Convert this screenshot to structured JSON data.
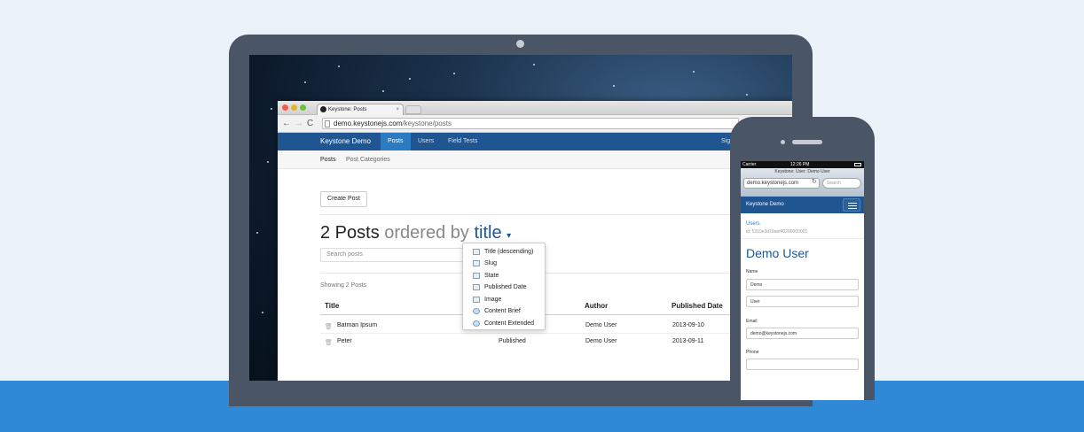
{
  "browser": {
    "tab_title": "Keystone: Posts",
    "url_host": "demo.keystonejs.com",
    "url_path": "/keystone/posts"
  },
  "navbar": {
    "brand": "Keystone Demo",
    "items": [
      "Posts",
      "Users",
      "Field Tests"
    ],
    "right_label": "Sig"
  },
  "subnav": {
    "items": [
      "Posts",
      "Post Categories"
    ]
  },
  "main": {
    "create_button": "Create Post",
    "heading_count": "2 Posts",
    "heading_ordered": "ordered by",
    "heading_sortkey": "title",
    "search_placeholder": "Search posts",
    "showing": "Showing 2 Posts",
    "columns": [
      "Title",
      "Author",
      "Published Date"
    ],
    "rows": [
      {
        "title": "Batman Ipsum",
        "state": "",
        "author": "Demo User",
        "date": "2013-09-10"
      },
      {
        "title": "Peter",
        "state": "Published",
        "author": "Demo User",
        "date": "2013-09-11"
      }
    ]
  },
  "sort_dropdown": {
    "options": [
      "Title (descending)",
      "Slug",
      "State",
      "Published Date",
      "Image",
      "Content Brief",
      "Content Extended"
    ]
  },
  "phone": {
    "status_carrier": "Carrier",
    "status_time": "12:26 PM",
    "page_title": "Keystone: User: Demo User",
    "url": "demo.keystonejs.com",
    "search_placeholder": "Search",
    "brand": "Keystone Demo",
    "breadcrumb": "Users",
    "record_id": "id: 5210e3d19aef40200000001",
    "heading": "Demo User",
    "fields": {
      "name_label": "Name",
      "first_name": "Demo",
      "last_name": "User",
      "email_label": "Email",
      "email": "demo@keystonejs.com",
      "phone_label": "Phone",
      "phone": ""
    }
  },
  "colors": {
    "navbar": "#1f5590",
    "active_nav": "#2b7bc0",
    "bottom_band": "#2f89d6",
    "background": "#ebf2fa",
    "device_frame": "#4a5566"
  }
}
